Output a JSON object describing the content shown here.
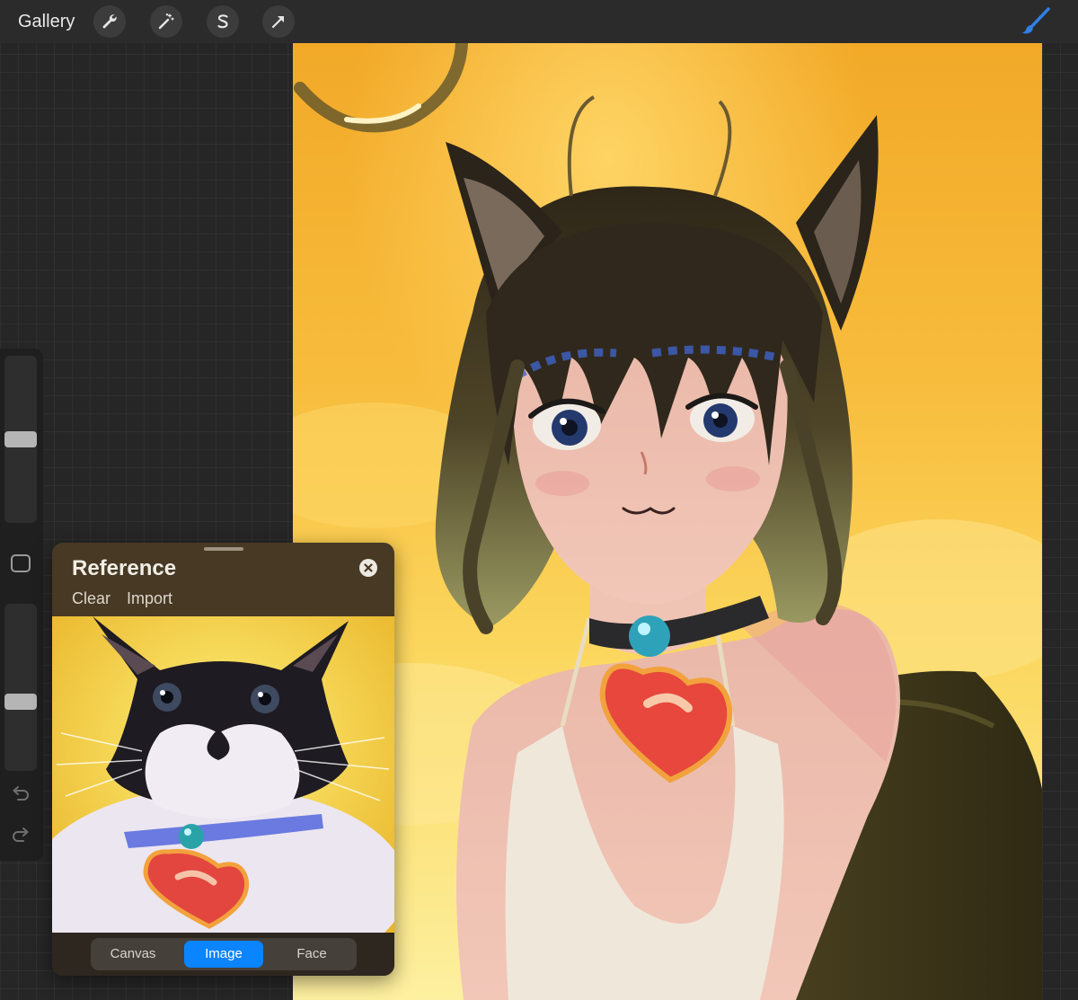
{
  "topbar": {
    "gallery_label": "Gallery",
    "tools": [
      {
        "name": "actions",
        "icon": "wrench-icon"
      },
      {
        "name": "adjustments",
        "icon": "magic-wand-icon"
      },
      {
        "name": "selection",
        "icon": "selection-s-icon"
      },
      {
        "name": "transform",
        "icon": "arrow-cursor-icon"
      }
    ],
    "brush_icon": "paintbrush-icon",
    "brush_color": "#2f7fe6"
  },
  "sidebar": {
    "brush_size_level": 0.5,
    "opacity_level": 0.4,
    "modify_icon": "square-icon",
    "undo_icon": "undo-icon",
    "redo_icon": "redo-icon"
  },
  "reference": {
    "title": "Reference",
    "clear_label": "Clear",
    "import_label": "Import",
    "close_icon": "close-circle-icon",
    "tabs": [
      {
        "label": "Canvas",
        "active": false
      },
      {
        "label": "Image",
        "active": true
      },
      {
        "label": "Face",
        "active": false
      }
    ],
    "accent_color": "#0a84ff"
  }
}
